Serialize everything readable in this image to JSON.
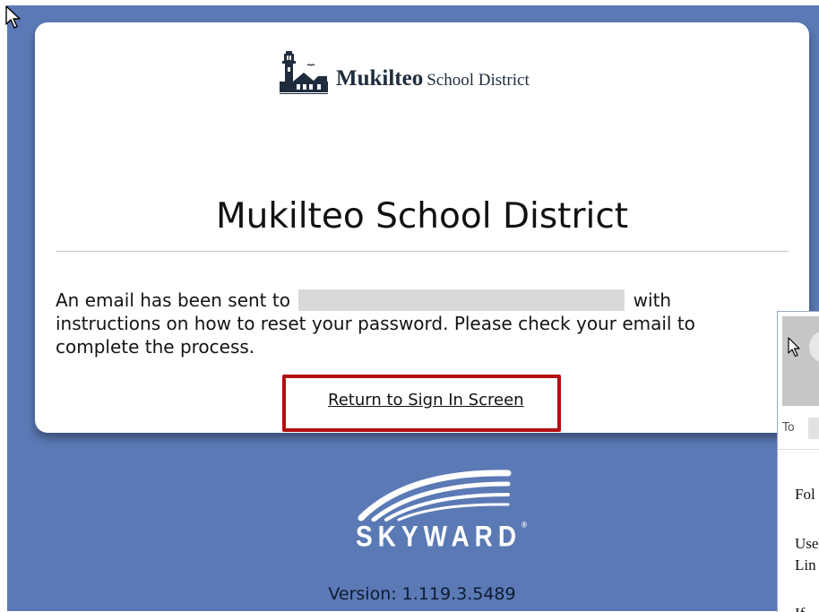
{
  "district": {
    "logo_name": "Mukilteo",
    "logo_suffix": "School District",
    "title": "Mukilteo School District"
  },
  "message": {
    "part1": "An email has been sent to",
    "part2": "with instructions on how to reset your password. Please check your email to complete the process."
  },
  "return_link": "Return to Sign In Screen",
  "branding": {
    "name": "SKYWARD",
    "version": "Version: 1.119.3.5489"
  },
  "email_preview": {
    "to_label": "To",
    "line1": "Fol",
    "line2": "Use",
    "line3": "Lin",
    "line4": "If"
  },
  "colors": {
    "background": "#5b79b5",
    "highlight": "#b30f12",
    "card": "#ffffff"
  }
}
